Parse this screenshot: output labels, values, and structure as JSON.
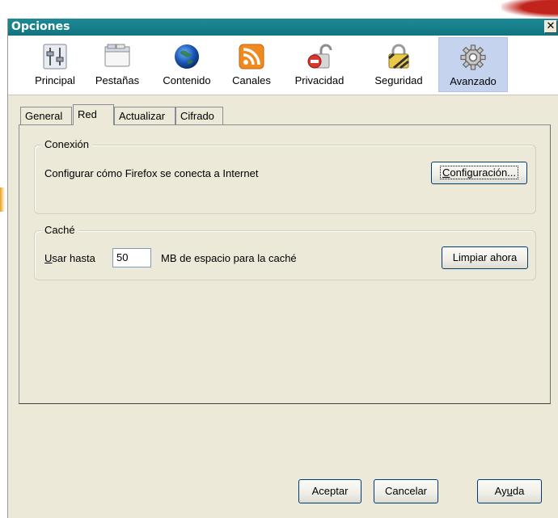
{
  "window": {
    "title": "Opciones",
    "close_glyph": "✕"
  },
  "toolbar": {
    "items": [
      {
        "label": "Principal",
        "icon": "sliders-icon"
      },
      {
        "label": "Pestañas",
        "icon": "tabs-window-icon"
      },
      {
        "label": "Contenido",
        "icon": "globe-icon"
      },
      {
        "label": "Canales",
        "icon": "rss-icon"
      },
      {
        "label": "Privacidad",
        "icon": "privacy-lock-icon"
      },
      {
        "label": "Seguridad",
        "icon": "security-padlock-icon"
      },
      {
        "label": "Avanzado",
        "icon": "gear-icon",
        "selected": true
      }
    ]
  },
  "tabs": [
    {
      "label": "General"
    },
    {
      "label": "Red",
      "active": true
    },
    {
      "label": "Actualizar"
    },
    {
      "label": "Cifrado"
    }
  ],
  "connection": {
    "title": "Conexión",
    "description": "Configurar cómo Firefox se conecta a Internet",
    "settings_button_pre": "",
    "settings_button_accel": "C",
    "settings_button_post": "onfiguración..."
  },
  "cache": {
    "title": "Caché",
    "use_up_to_accel": "U",
    "use_up_to_rest": "sar hasta",
    "size_value": "50",
    "size_suffix": "MB de espacio para la caché",
    "clear_button": "Limpiar ahora"
  },
  "dialog_buttons": {
    "accept": "Aceptar",
    "cancel": "Cancelar",
    "help_pre": "Ay",
    "help_accel": "u",
    "help_post": "da"
  },
  "colors": {
    "titlebar": "#17808b",
    "selected_toolbar_item": "#c6d3ef",
    "dialog_bg": "#ece9d8"
  }
}
